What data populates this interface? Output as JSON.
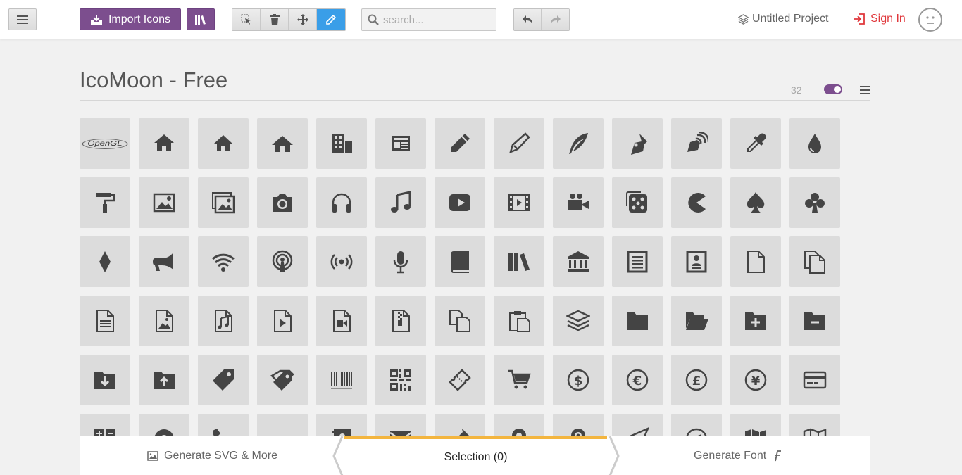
{
  "topbar": {
    "import_label": "Import Icons",
    "search_placeholder": "search...",
    "project_name": "Untitled Project",
    "signin_label": "Sign In"
  },
  "set": {
    "title": "IcoMoon - Free",
    "size": "32"
  },
  "icons": [
    "opengl",
    "home",
    "home2",
    "home3",
    "office",
    "newspaper",
    "pencil",
    "pencil2",
    "quill",
    "pen",
    "blog",
    "eyedropper",
    "droplet",
    "paint-format",
    "image",
    "images",
    "camera",
    "headphones",
    "music",
    "play",
    "film",
    "video-camera",
    "dice",
    "pacman",
    "spades",
    "clubs",
    "diamonds",
    "bullhorn",
    "connection",
    "podcast",
    "feed",
    "mic",
    "book",
    "books",
    "library",
    "file-text",
    "profile",
    "file-empty",
    "files-empty",
    "file-text2",
    "file-picture",
    "file-music",
    "file-play",
    "file-video",
    "file-zip",
    "copy",
    "paste",
    "stack",
    "folder",
    "folder-open",
    "folder-plus",
    "folder-minus",
    "folder-download",
    "folder-upload",
    "price-tag",
    "price-tags",
    "barcode",
    "qrcode",
    "ticket",
    "cart",
    "coin-dollar",
    "coin-euro",
    "coin-pound",
    "coin-yen",
    "credit-card",
    "calculator",
    "lifebuoy",
    "phone",
    "phone-hang-up",
    "address-book",
    "envelop",
    "pushpin",
    "location",
    "location2",
    "compass",
    "compass2",
    "map",
    "map2"
  ],
  "opengl_text": "OpenGL",
  "bottom": {
    "generate_svg": "Generate SVG & More",
    "selection": "Selection (0)",
    "generate_font": "Generate Font"
  },
  "colors": {
    "accent_purple": "#7c4e8e",
    "active_blue": "#3a9ee8",
    "signin_red": "#e0383c",
    "selection_bar": "#f3b53f"
  }
}
